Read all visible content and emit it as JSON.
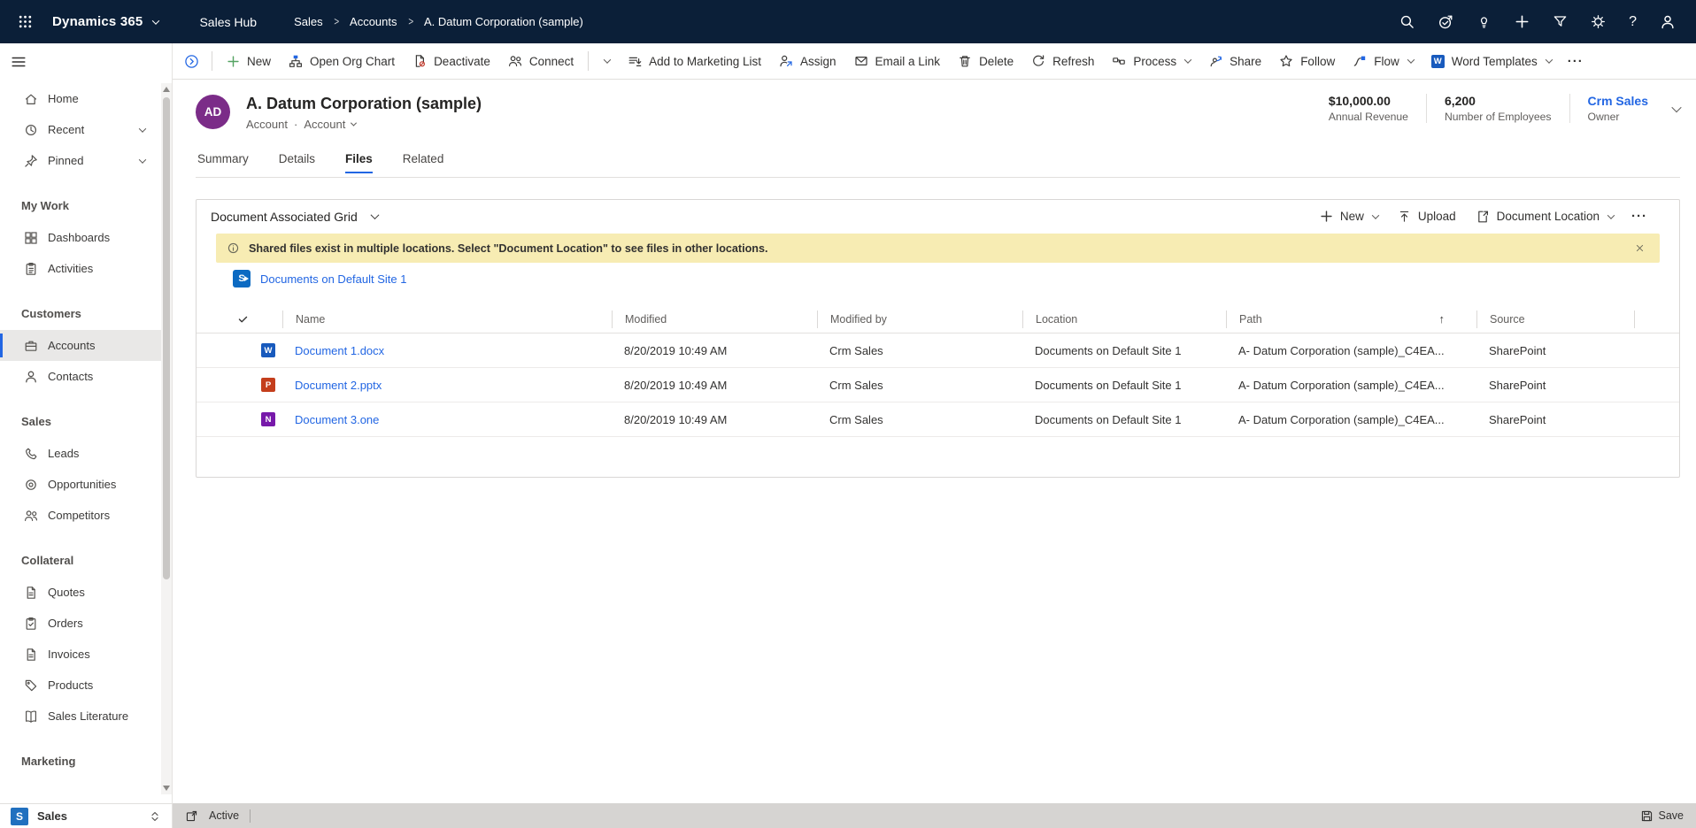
{
  "colors": {
    "topbar": "#0b1f38",
    "accent": "#2266e3",
    "banner": "#f7ecb3",
    "avatar": "#7b2c88",
    "word": "#185abd",
    "powerpoint": "#c43e1c",
    "onenote": "#7719aa",
    "sharepoint": "#0c6ac2",
    "statusbar": "#d6d4d2",
    "sales_tile": "#2170bf"
  },
  "topbar": {
    "app_title": "Dynamics 365",
    "hub_name": "Sales Hub",
    "breadcrumb": [
      "Sales",
      "Accounts",
      "A. Datum Corporation (sample)"
    ],
    "right_icons": [
      "search-icon",
      "check-circle-icon",
      "lightbulb-icon",
      "plus-icon",
      "filter-icon",
      "settings-gear-icon",
      "help-icon",
      "account-person-icon"
    ],
    "help_glyph": "?"
  },
  "command_bar": {
    "items": [
      {
        "label": "New",
        "icon": "plus-icon"
      },
      {
        "label": "Open Org Chart",
        "icon": "org-chart-icon"
      },
      {
        "label": "Deactivate",
        "icon": "deactivate-icon"
      },
      {
        "label": "Connect",
        "icon": "connect-people-icon"
      },
      {
        "label": "Add to Marketing List",
        "icon": "marketing-list-icon"
      },
      {
        "label": "Assign",
        "icon": "assign-person-icon"
      },
      {
        "label": "Email a Link",
        "icon": "email-icon"
      },
      {
        "label": "Delete",
        "icon": "trash-icon"
      },
      {
        "label": "Refresh",
        "icon": "refresh-icon"
      },
      {
        "label": "Process",
        "icon": "process-icon"
      },
      {
        "label": "Share",
        "icon": "share-icon"
      },
      {
        "label": "Follow",
        "icon": "star-icon"
      },
      {
        "label": "Flow",
        "icon": "flow-icon"
      },
      {
        "label": "Word Templates",
        "icon": "word-icon",
        "tile_letter": "W"
      }
    ],
    "overflow": "···"
  },
  "record_header": {
    "initials": "AD",
    "title": "A. Datum Corporation (sample)",
    "entity_label": "Account",
    "separator": "·",
    "form_label": "Account",
    "stats": [
      {
        "value": "$10,000.00",
        "label": "Annual Revenue"
      },
      {
        "value": "6,200",
        "label": "Number of Employees"
      },
      {
        "value": "Crm Sales",
        "label": "Owner",
        "is_link": true
      }
    ]
  },
  "tabs": {
    "items": [
      {
        "label": "Summary"
      },
      {
        "label": "Details"
      },
      {
        "label": "Files",
        "active": true
      },
      {
        "label": "Related"
      }
    ]
  },
  "files_grid": {
    "title": "Document Associated Grid",
    "toolbar": {
      "new_label": "New",
      "upload_label": "Upload",
      "location_label": "Document Location",
      "overflow": "···"
    },
    "banner": {
      "text": "Shared files exist in multiple locations. Select \"Document Location\" to see files in other locations."
    },
    "location_link": {
      "label": "Documents on Default Site 1"
    },
    "table": {
      "columns": [
        "Name",
        "Modified",
        "Modified by",
        "Location",
        "Path",
        "Source"
      ],
      "sort_column": "Path",
      "sort_glyph": "↑",
      "rows": [
        {
          "name": "Document 1.docx",
          "type": "word",
          "letter": "W",
          "modified": "8/20/2019 10:49 AM",
          "modified_by": "Crm Sales",
          "location": "Documents on Default Site 1",
          "path": "A- Datum Corporation (sample)_C4EA...",
          "source": "SharePoint"
        },
        {
          "name": "Document 2.pptx",
          "type": "powerpoint",
          "letter": "P",
          "modified": "8/20/2019 10:49 AM",
          "modified_by": "Crm Sales",
          "location": "Documents on Default Site 1",
          "path": "A- Datum Corporation (sample)_C4EA...",
          "source": "SharePoint"
        },
        {
          "name": "Document 3.one",
          "type": "onenote",
          "letter": "N",
          "modified": "8/20/2019 10:49 AM",
          "modified_by": "Crm Sales",
          "location": "Documents on Default Site 1",
          "path": "A- Datum Corporation (sample)_C4EA...",
          "source": "SharePoint"
        }
      ]
    }
  },
  "sidebar": {
    "groups": [
      {
        "items": [
          {
            "label": "Home"
          },
          {
            "label": "Recent",
            "chevron": true
          },
          {
            "label": "Pinned",
            "chevron": true
          }
        ]
      },
      {
        "label": "My Work",
        "items": [
          {
            "label": "Dashboards"
          },
          {
            "label": "Activities"
          }
        ]
      },
      {
        "label": "Customers",
        "items": [
          {
            "label": "Accounts",
            "selected": true
          },
          {
            "label": "Contacts"
          }
        ]
      },
      {
        "label": "Sales",
        "items": [
          {
            "label": "Leads"
          },
          {
            "label": "Opportunities"
          },
          {
            "label": "Competitors"
          }
        ]
      },
      {
        "label": "Collateral",
        "items": [
          {
            "label": "Quotes"
          },
          {
            "label": "Orders"
          },
          {
            "label": "Invoices"
          },
          {
            "label": "Products"
          },
          {
            "label": "Sales Literature"
          }
        ]
      },
      {
        "label": "Marketing",
        "items": []
      }
    ],
    "footer": {
      "initial": "S",
      "label": "Sales"
    }
  },
  "status_bar": {
    "state": "Active",
    "save_label": "Save"
  }
}
